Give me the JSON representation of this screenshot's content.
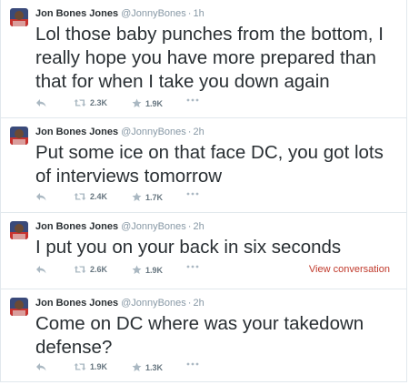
{
  "tweets": [
    {
      "name": "Jon Bones Jones",
      "handle": "@JonnyBones",
      "dot": "·",
      "time": "1h",
      "text": "Lol those baby punches from the bottom, I really hope you have more prepared than that for when I take you down again",
      "retweets": "2.3K",
      "favorites": "1.9K",
      "view_conversation": ""
    },
    {
      "name": "Jon Bones Jones",
      "handle": "@JonnyBones",
      "dot": "·",
      "time": "2h",
      "text": "Put some ice on that face DC, you got lots of interviews tomorrow",
      "retweets": "2.4K",
      "favorites": "1.7K",
      "view_conversation": ""
    },
    {
      "name": "Jon Bones Jones",
      "handle": "@JonnyBones",
      "dot": "·",
      "time": "2h",
      "text": "I put you on your back in six seconds",
      "retweets": "2.6K",
      "favorites": "1.9K",
      "view_conversation": "View conversation"
    },
    {
      "name": "Jon Bones Jones",
      "handle": "@JonnyBones",
      "dot": "·",
      "time": "2h",
      "text": "Come on DC where was your takedown defense?",
      "retweets": "1.9K",
      "favorites": "1.3K",
      "view_conversation": ""
    }
  ],
  "icons": {
    "reply": "reply-icon",
    "retweet": "retweet-icon",
    "favorite": "star-icon",
    "more": "more-dots-icon"
  },
  "colors": {
    "text": "#292f33",
    "meta": "#8899a6",
    "link": "#c0392b",
    "border": "#e1e8ed"
  }
}
